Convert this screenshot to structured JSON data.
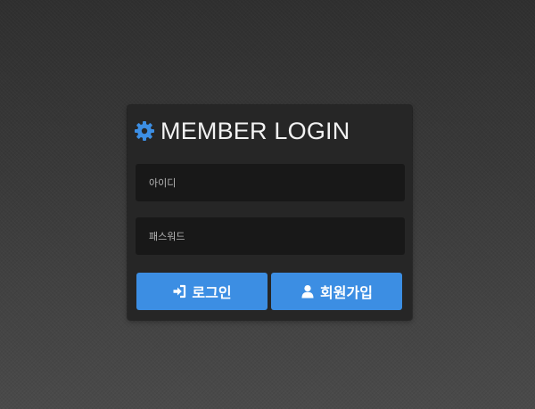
{
  "login": {
    "title": "MEMBER LOGIN",
    "title_icon": "gear-icon",
    "id_placeholder": "아이디",
    "password_placeholder": "패스워드",
    "login_button_label": "로그인",
    "login_button_icon": "sign-in-icon",
    "join_button_label": "회원가입",
    "join_button_icon": "user-icon"
  },
  "colors": {
    "accent": "#3c8ee3",
    "panel": "#262626",
    "field": "#181818",
    "title_text": "#f2f2f2"
  }
}
